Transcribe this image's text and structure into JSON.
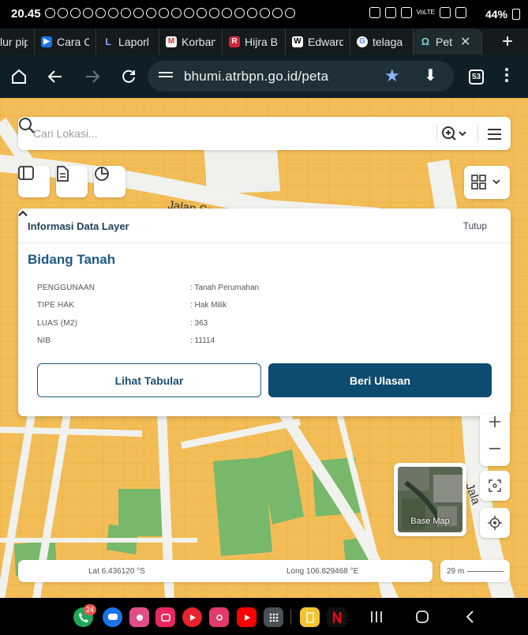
{
  "status_bar": {
    "time": "20.45",
    "network_label": "VoLTE",
    "battery": "44%"
  },
  "tabs": [
    {
      "title": "lur pip",
      "icon": "page-icon"
    },
    {
      "title": "Cara Cc",
      "icon": "play-store-icon"
    },
    {
      "title": "Laporl",
      "icon": "laporan-icon"
    },
    {
      "title": "Korban",
      "icon": "gmail-icon"
    },
    {
      "title": "Hijra B",
      "icon": "r-icon"
    },
    {
      "title": "Edward",
      "icon": "wikipedia-icon"
    },
    {
      "title": "telaga",
      "icon": "google-icon"
    },
    {
      "title": "Pet",
      "icon": "bhumi-icon",
      "active": true
    }
  ],
  "toolbar": {
    "url": "bhumi.atrbpn.go.id/peta",
    "tab_count": "53"
  },
  "map": {
    "road_label": "Jalan Sm",
    "road_label_2": "Jala",
    "search": {
      "placeholder": "Cari Lokasi..."
    },
    "info_panel": {
      "title": "Informasi Data Layer",
      "close_label": "Tutup",
      "parcel_title": "Bidang Tanah",
      "attributes": [
        {
          "label": "PENGGUNAAN",
          "value": ": Tanah Perumahan"
        },
        {
          "label": "TIPE HAK",
          "value": ": Hak Milik"
        },
        {
          "label": "LUAS (M2)",
          "value": ": 363"
        },
        {
          "label": "NIB",
          "value": ": 11114"
        }
      ],
      "tabular_button": "Lihat Tabular",
      "review_button": "Beri Ulasan"
    },
    "basemap_label": "Base Map",
    "coords": {
      "lat": "Lat 6.436120 °S",
      "long": "Long 106.829468 °E"
    },
    "scale": "29 m"
  },
  "colors": {
    "parcel": "#f2bd56",
    "green_space": "#78b86a",
    "road": "#f1f1ee",
    "primary": "#0d4b6f",
    "title": "#1d5a86"
  },
  "nav_bar": {
    "phone_badge": "24"
  }
}
